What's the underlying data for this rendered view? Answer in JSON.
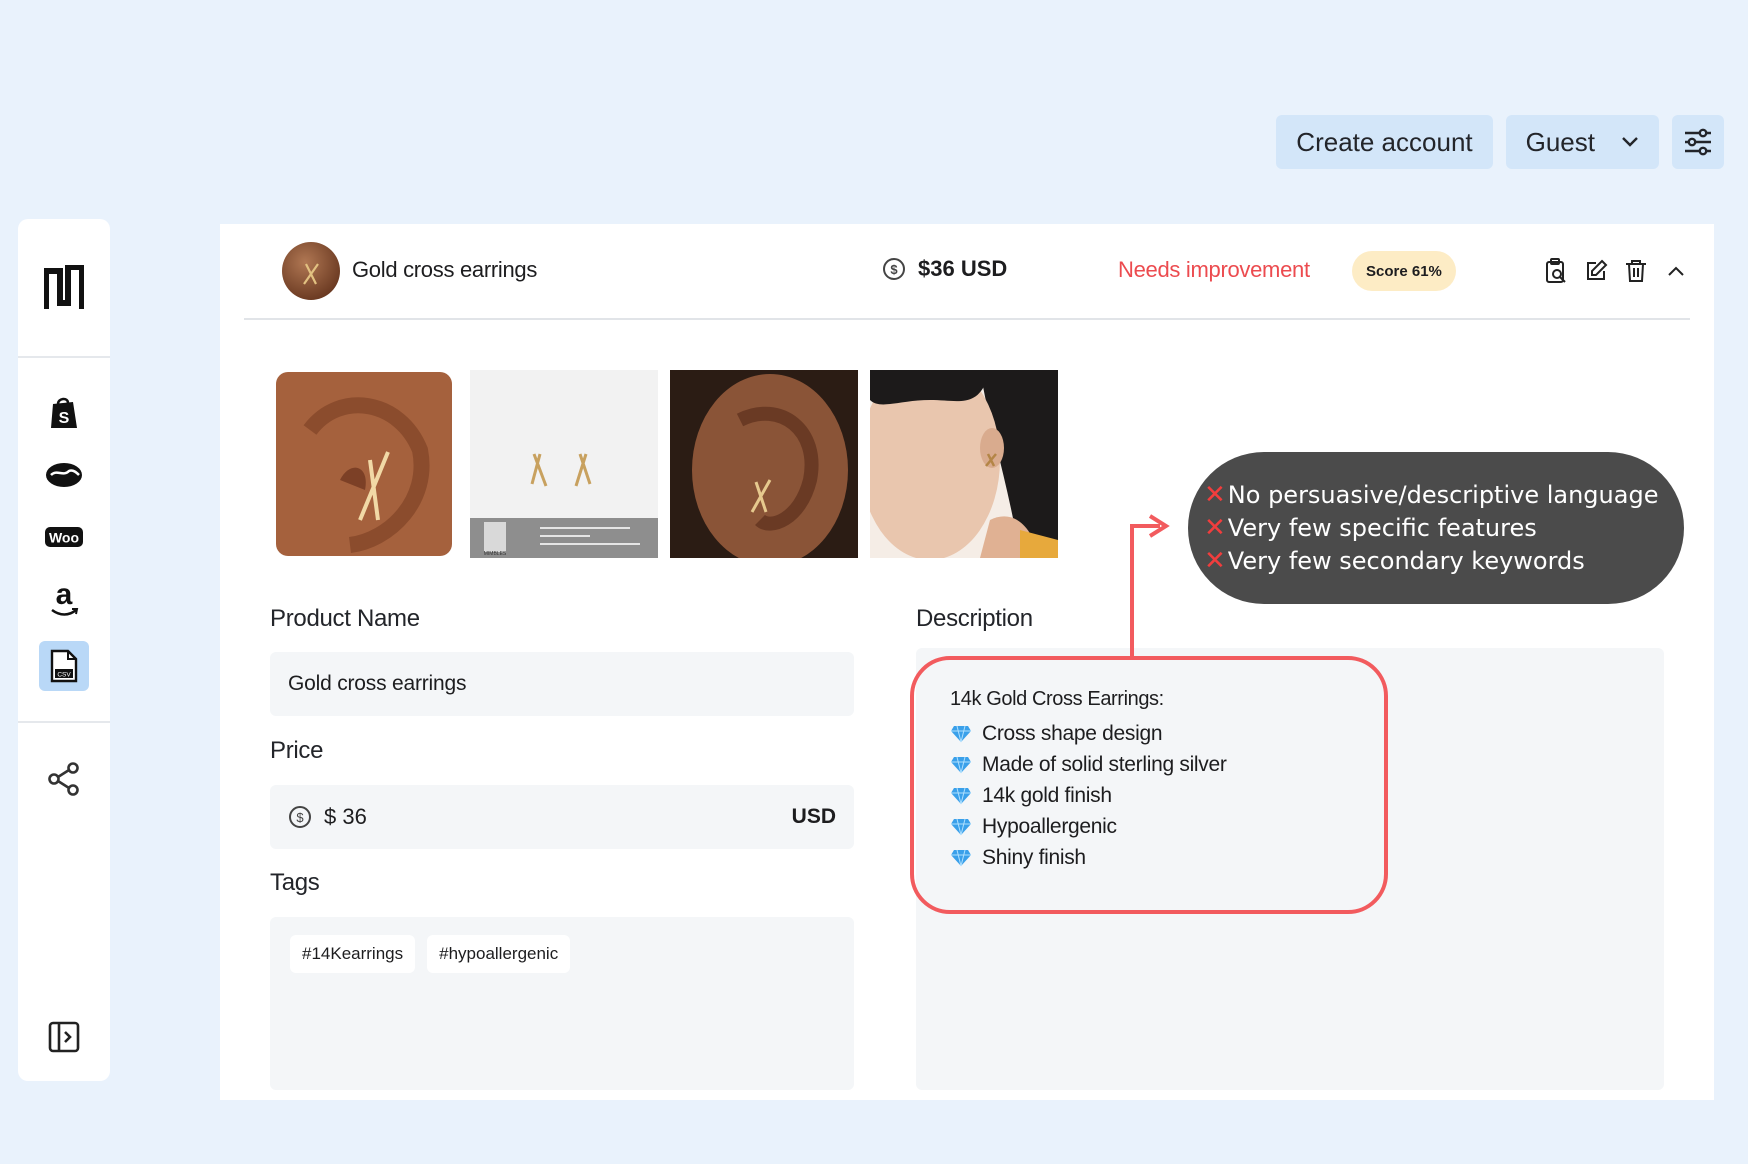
{
  "topbar": {
    "create_account": "Create account",
    "guest": "Guest"
  },
  "sidebar": {
    "items": [
      {
        "name": "shopify-icon"
      },
      {
        "name": "handshake-icon"
      },
      {
        "name": "woo-icon",
        "label": "Woo"
      },
      {
        "name": "amazon-icon",
        "label": "a"
      },
      {
        "name": "csv-file-icon",
        "label": "CSV",
        "active": true
      },
      {
        "name": "share-icon"
      },
      {
        "name": "sidebar-expand-icon"
      }
    ]
  },
  "product": {
    "name": "Gold cross earrings",
    "price_display": "$36 USD",
    "status": "Needs improvement",
    "score": "Score 61%",
    "packaging_brand": "MIMBLES"
  },
  "form": {
    "product_name_label": "Product Name",
    "product_name_value": "Gold cross earrings",
    "price_label": "Price",
    "price_value": "$ 36",
    "currency": "USD",
    "tags_label": "Tags",
    "tags": [
      "#14Kearrings",
      "#hypoallergenic"
    ],
    "description_label": "Description",
    "description": {
      "title": "14k Gold Cross Earrings:",
      "bullets": [
        "Cross shape design",
        "Made of solid sterling silver",
        "14k gold finish",
        "Hypoallergenic",
        "Shiny finish"
      ]
    }
  },
  "feedback": {
    "items": [
      "No persuasive/descriptive language",
      "Very few specific features",
      "Very few secondary keywords"
    ]
  },
  "colors": {
    "background": "#e9f2fc",
    "button": "#d3e6f9",
    "status_red": "#ec4b4f",
    "score_badge": "#fdecc5",
    "highlight_red": "#f25b5e",
    "bubble": "#4b4b4b"
  }
}
